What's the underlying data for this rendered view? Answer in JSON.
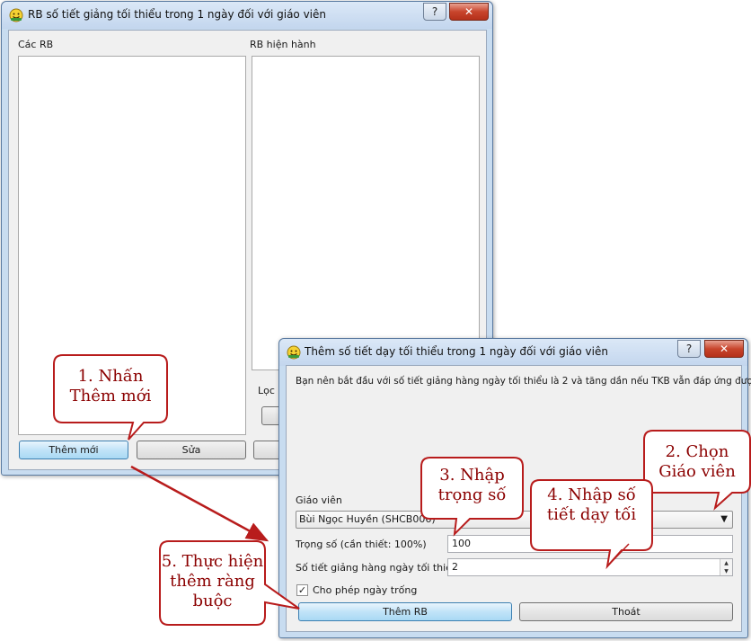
{
  "colors": {
    "callout_border": "#b81c1c",
    "callout_text": "#8b0000",
    "arrow": "#b81c1c",
    "close_button": "#c8452c",
    "active_button": "#c1e3f8"
  },
  "main_window": {
    "title": "RB số tiết giảng tối thiểu trong 1 ngày đối với giáo viên",
    "help_label": "?",
    "close_label": "✕",
    "rules_label": "Các RB",
    "current_label": "RB hiện hành",
    "filter_label": "Lọc",
    "add_button": "Thêm mới",
    "edit_button": "Sửa"
  },
  "dialog": {
    "title": "Thêm số tiết dạy tối thiểu trong 1 ngày đối với giáo viên",
    "help_label": "?",
    "close_label": "✕",
    "info_text": "Bạn nên bắt đầu với số tiết giảng hàng ngày tối thiểu là 2 và tăng dần nếu TKB vẫn đáp ứng được.",
    "teacher_label": "Giáo viên",
    "teacher_value": "Bùi Ngọc Huyền (SHCB006)",
    "weight_label": "Trọng số (cần thiết: 100%)",
    "weight_value": "100",
    "min_hours_label": "Số tiết giảng hàng ngày tối thiểu",
    "min_hours_value": "2",
    "allow_empty_label": "Cho phép ngày trống",
    "allow_empty_checked": true,
    "add_rule_button": "Thêm RB",
    "exit_button": "Thoát"
  },
  "callouts": [
    {
      "lines": [
        "1. Nhấn",
        "Thêm mới"
      ]
    },
    {
      "lines": [
        "2. Chọn",
        "Giáo viên"
      ]
    },
    {
      "lines": [
        "3. Nhập",
        "trọng số"
      ]
    },
    {
      "lines": [
        "4. Nhập số",
        "tiết dạy tối"
      ]
    },
    {
      "lines": [
        "5. Thực hiện",
        "thêm ràng",
        "buộc"
      ]
    }
  ],
  "icons": {
    "app": "smiley-app-icon",
    "help": "question-mark-icon",
    "close": "close-x-icon",
    "dropdown": "triangle-down-icon",
    "spinner": "spin-arrows-icon",
    "check": "checkmark-icon",
    "arrow": "red-arrow-icon"
  }
}
